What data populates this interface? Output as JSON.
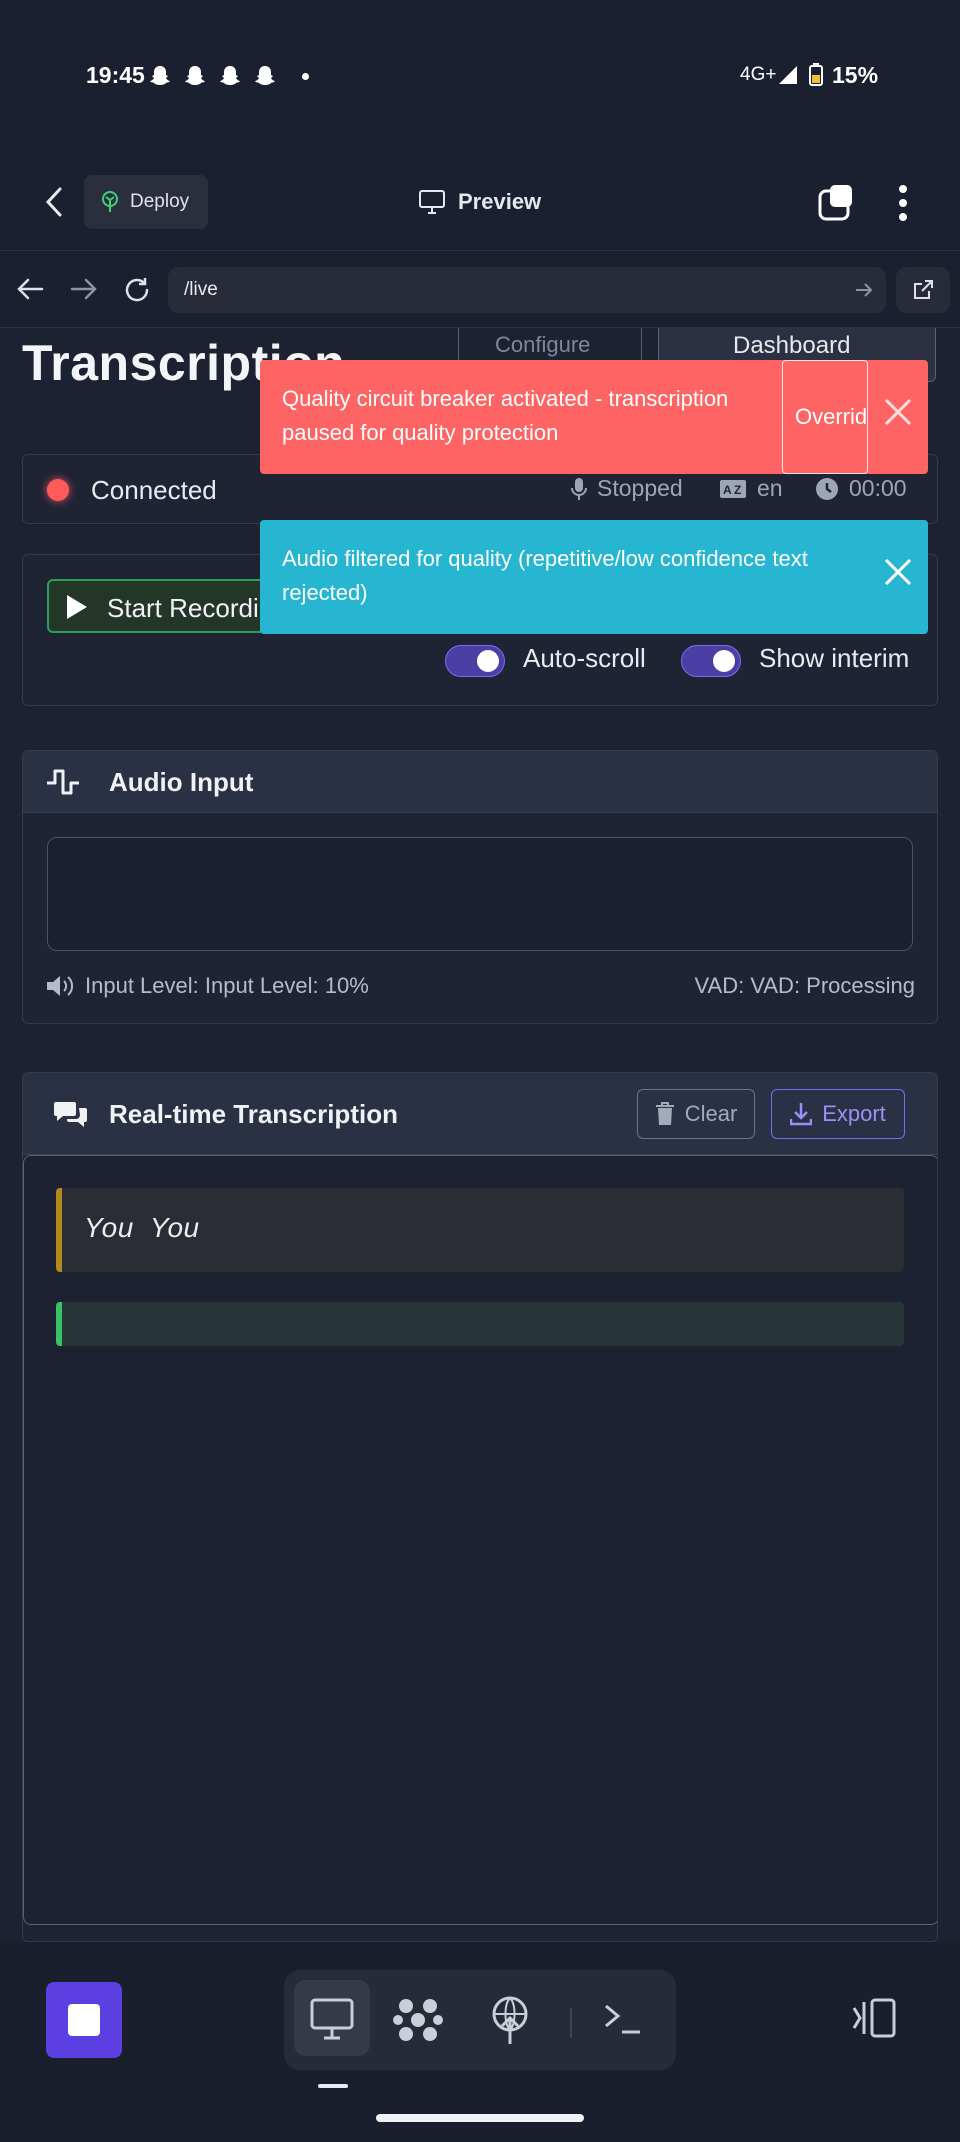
{
  "status_bar": {
    "time": "19:45",
    "network": "4G+",
    "battery": "15%"
  },
  "app_bar": {
    "deploy_label": "Deploy",
    "preview_label": "Preview"
  },
  "browser": {
    "url": "/live"
  },
  "page": {
    "title": "Transcription",
    "configure_label": "Configure",
    "dashboard_label": "Dashboard"
  },
  "connection": {
    "status": "Connected",
    "recording_state": "Stopped",
    "language": "en",
    "timer": "00:00"
  },
  "controls": {
    "record_label": "Start Recording",
    "autoscroll_label": "Auto-scroll",
    "interim_label": "Show interim"
  },
  "audio": {
    "title": "Audio Input",
    "input_level": "Input Level: Input Level: 10%",
    "vad": "VAD: VAD: Processing"
  },
  "transcription": {
    "title": "Real-time Transcription",
    "clear_label": "Clear",
    "export_label": "Export",
    "interim_text": "You  You",
    "final_text": ""
  },
  "toasts": {
    "error_text": "Quality circuit breaker activated - transcription paused for quality protection",
    "override_label": "Override",
    "info_text": "Audio filtered for quality (repetitive/low confidence text rejected)"
  },
  "colors": {
    "background": "#1d2233",
    "accent": "#5b3fe0",
    "error": "#ff6464",
    "info": "#27b6d2",
    "success": "#38c26a"
  }
}
